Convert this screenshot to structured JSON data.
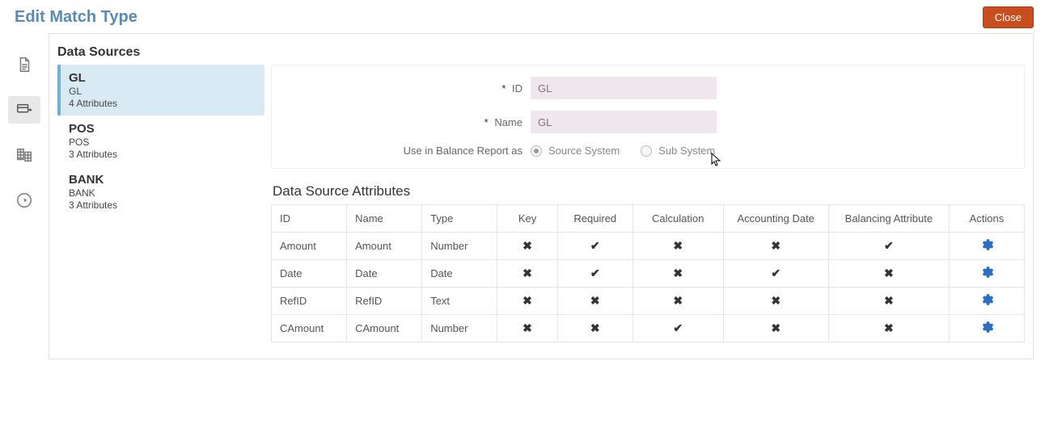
{
  "header": {
    "title": "Edit Match Type",
    "close_label": "Close"
  },
  "left_rail": {
    "icons": [
      "document-icon",
      "datasource-icon",
      "spreadsheet-icon",
      "click-target-icon"
    ],
    "active_index": 1
  },
  "data_sources": {
    "heading": "Data Sources",
    "items": [
      {
        "title": "GL",
        "sub": "GL",
        "attr": "4 Attributes",
        "selected": true
      },
      {
        "title": "POS",
        "sub": "POS",
        "attr": "3 Attributes",
        "selected": false
      },
      {
        "title": "BANK",
        "sub": "BANK",
        "attr": "3 Attributes",
        "selected": false
      }
    ]
  },
  "form": {
    "id_label": "ID",
    "id_value": "GL",
    "name_label": "Name",
    "name_value": "GL",
    "balance_label": "Use in Balance Report as",
    "radio_source": "Source System",
    "radio_sub": "Sub System",
    "radio_selected": "source"
  },
  "attributes": {
    "heading": "Data Source Attributes",
    "columns": {
      "id": "ID",
      "name": "Name",
      "type": "Type",
      "key": "Key",
      "required": "Required",
      "calculation": "Calculation",
      "accounting_date": "Accounting Date",
      "balancing": "Balancing Attribute",
      "actions": "Actions"
    },
    "rows": [
      {
        "id": "Amount",
        "name": "Amount",
        "type": "Number",
        "key": false,
        "required": true,
        "calculation": false,
        "accounting_date": false,
        "balancing": true
      },
      {
        "id": "Date",
        "name": "Date",
        "type": "Date",
        "key": false,
        "required": true,
        "calculation": false,
        "accounting_date": true,
        "balancing": false
      },
      {
        "id": "RefID",
        "name": "RefID",
        "type": "Text",
        "key": false,
        "required": false,
        "calculation": false,
        "accounting_date": false,
        "balancing": false
      },
      {
        "id": "CAmount",
        "name": "CAmount",
        "type": "Number",
        "key": false,
        "required": false,
        "calculation": true,
        "accounting_date": false,
        "balancing": false
      }
    ]
  },
  "marks": {
    "check": "✔",
    "cross": "✖"
  }
}
